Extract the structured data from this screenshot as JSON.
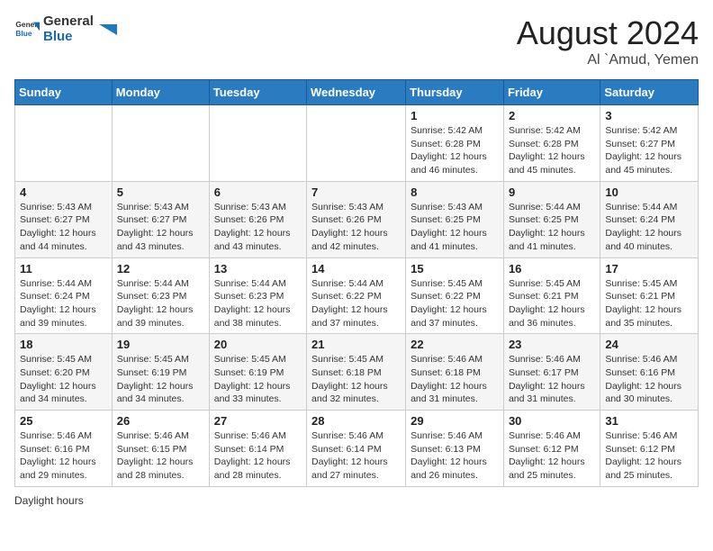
{
  "header": {
    "logo_general": "General",
    "logo_blue": "Blue",
    "month_title": "August 2024",
    "location": "Al `Amud, Yemen"
  },
  "days_of_week": [
    "Sunday",
    "Monday",
    "Tuesday",
    "Wednesday",
    "Thursday",
    "Friday",
    "Saturday"
  ],
  "weeks": [
    [
      {
        "day": "",
        "info": ""
      },
      {
        "day": "",
        "info": ""
      },
      {
        "day": "",
        "info": ""
      },
      {
        "day": "",
        "info": ""
      },
      {
        "day": "1",
        "info": "Sunrise: 5:42 AM\nSunset: 6:28 PM\nDaylight: 12 hours and 46 minutes."
      },
      {
        "day": "2",
        "info": "Sunrise: 5:42 AM\nSunset: 6:28 PM\nDaylight: 12 hours and 45 minutes."
      },
      {
        "day": "3",
        "info": "Sunrise: 5:42 AM\nSunset: 6:27 PM\nDaylight: 12 hours and 45 minutes."
      }
    ],
    [
      {
        "day": "4",
        "info": "Sunrise: 5:43 AM\nSunset: 6:27 PM\nDaylight: 12 hours and 44 minutes."
      },
      {
        "day": "5",
        "info": "Sunrise: 5:43 AM\nSunset: 6:27 PM\nDaylight: 12 hours and 43 minutes."
      },
      {
        "day": "6",
        "info": "Sunrise: 5:43 AM\nSunset: 6:26 PM\nDaylight: 12 hours and 43 minutes."
      },
      {
        "day": "7",
        "info": "Sunrise: 5:43 AM\nSunset: 6:26 PM\nDaylight: 12 hours and 42 minutes."
      },
      {
        "day": "8",
        "info": "Sunrise: 5:43 AM\nSunset: 6:25 PM\nDaylight: 12 hours and 41 minutes."
      },
      {
        "day": "9",
        "info": "Sunrise: 5:44 AM\nSunset: 6:25 PM\nDaylight: 12 hours and 41 minutes."
      },
      {
        "day": "10",
        "info": "Sunrise: 5:44 AM\nSunset: 6:24 PM\nDaylight: 12 hours and 40 minutes."
      }
    ],
    [
      {
        "day": "11",
        "info": "Sunrise: 5:44 AM\nSunset: 6:24 PM\nDaylight: 12 hours and 39 minutes."
      },
      {
        "day": "12",
        "info": "Sunrise: 5:44 AM\nSunset: 6:23 PM\nDaylight: 12 hours and 39 minutes."
      },
      {
        "day": "13",
        "info": "Sunrise: 5:44 AM\nSunset: 6:23 PM\nDaylight: 12 hours and 38 minutes."
      },
      {
        "day": "14",
        "info": "Sunrise: 5:44 AM\nSunset: 6:22 PM\nDaylight: 12 hours and 37 minutes."
      },
      {
        "day": "15",
        "info": "Sunrise: 5:45 AM\nSunset: 6:22 PM\nDaylight: 12 hours and 37 minutes."
      },
      {
        "day": "16",
        "info": "Sunrise: 5:45 AM\nSunset: 6:21 PM\nDaylight: 12 hours and 36 minutes."
      },
      {
        "day": "17",
        "info": "Sunrise: 5:45 AM\nSunset: 6:21 PM\nDaylight: 12 hours and 35 minutes."
      }
    ],
    [
      {
        "day": "18",
        "info": "Sunrise: 5:45 AM\nSunset: 6:20 PM\nDaylight: 12 hours and 34 minutes."
      },
      {
        "day": "19",
        "info": "Sunrise: 5:45 AM\nSunset: 6:19 PM\nDaylight: 12 hours and 34 minutes."
      },
      {
        "day": "20",
        "info": "Sunrise: 5:45 AM\nSunset: 6:19 PM\nDaylight: 12 hours and 33 minutes."
      },
      {
        "day": "21",
        "info": "Sunrise: 5:45 AM\nSunset: 6:18 PM\nDaylight: 12 hours and 32 minutes."
      },
      {
        "day": "22",
        "info": "Sunrise: 5:46 AM\nSunset: 6:18 PM\nDaylight: 12 hours and 31 minutes."
      },
      {
        "day": "23",
        "info": "Sunrise: 5:46 AM\nSunset: 6:17 PM\nDaylight: 12 hours and 31 minutes."
      },
      {
        "day": "24",
        "info": "Sunrise: 5:46 AM\nSunset: 6:16 PM\nDaylight: 12 hours and 30 minutes."
      }
    ],
    [
      {
        "day": "25",
        "info": "Sunrise: 5:46 AM\nSunset: 6:16 PM\nDaylight: 12 hours and 29 minutes."
      },
      {
        "day": "26",
        "info": "Sunrise: 5:46 AM\nSunset: 6:15 PM\nDaylight: 12 hours and 28 minutes."
      },
      {
        "day": "27",
        "info": "Sunrise: 5:46 AM\nSunset: 6:14 PM\nDaylight: 12 hours and 28 minutes."
      },
      {
        "day": "28",
        "info": "Sunrise: 5:46 AM\nSunset: 6:14 PM\nDaylight: 12 hours and 27 minutes."
      },
      {
        "day": "29",
        "info": "Sunrise: 5:46 AM\nSunset: 6:13 PM\nDaylight: 12 hours and 26 minutes."
      },
      {
        "day": "30",
        "info": "Sunrise: 5:46 AM\nSunset: 6:12 PM\nDaylight: 12 hours and 25 minutes."
      },
      {
        "day": "31",
        "info": "Sunrise: 5:46 AM\nSunset: 6:12 PM\nDaylight: 12 hours and 25 minutes."
      }
    ]
  ],
  "footer": {
    "note": "Daylight hours"
  }
}
